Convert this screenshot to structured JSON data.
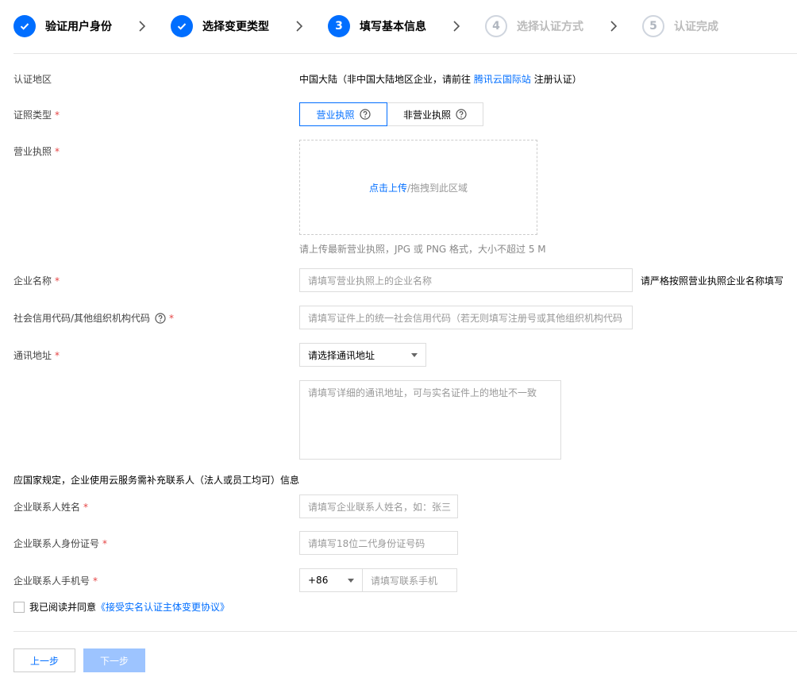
{
  "steps": [
    {
      "label": "验证用户身份",
      "state": "done",
      "number": ""
    },
    {
      "label": "选择变更类型",
      "state": "done",
      "number": ""
    },
    {
      "label": "填写基本信息",
      "state": "active",
      "number": "3"
    },
    {
      "label": "选择认证方式",
      "state": "todo",
      "number": "4"
    },
    {
      "label": "认证完成",
      "state": "todo",
      "number": "5"
    }
  ],
  "region": {
    "label": "认证地区",
    "value_prefix": "中国大陆（非中国大陆地区企业，请前往",
    "link": "腾讯云国际站",
    "value_suffix": "注册认证）"
  },
  "license_type": {
    "label": "证照类型",
    "required": "*",
    "options": [
      "营业执照",
      "非营业执照"
    ],
    "selected": "营业执照"
  },
  "license_upload": {
    "label": "营业执照",
    "required": "*",
    "link": "点击上传",
    "text": "/拖拽到此区域",
    "hint": "请上传最新营业执照，JPG 或 PNG 格式，大小不超过 5 M"
  },
  "company_name": {
    "label": "企业名称",
    "required": "*",
    "placeholder": "请填写营业执照上的企业名称",
    "note": "请严格按照营业执照企业名称填写"
  },
  "credit_code": {
    "label": "社会信用代码/其他组织机构代码",
    "required": "*",
    "placeholder": "请填写证件上的统一社会信用代码（若无则填写注册号或其他组织机构代码"
  },
  "address": {
    "label": "通讯地址",
    "required": "*",
    "select_value": "请选择通讯地址",
    "detail_placeholder": "请填写详细的通讯地址，可与实名证件上的地址不一致"
  },
  "contact_note": "应国家规定，企业使用云服务需补充联系人（法人或员工均可）信息",
  "contact_name": {
    "label": "企业联系人姓名",
    "required": "*",
    "placeholder": "请填写企业联系人姓名，如：张三"
  },
  "contact_id": {
    "label": "企业联系人身份证号",
    "required": "*",
    "placeholder": "请填写18位二代身份证号码"
  },
  "contact_phone": {
    "label": "企业联系人手机号",
    "required": "*",
    "country_code": "+86",
    "placeholder": "请填写联系手机"
  },
  "agreement": {
    "text": "我已阅读并同意",
    "link": "《接受实名认证主体变更协议》"
  },
  "buttons": {
    "prev": "上一步",
    "next": "下一步"
  },
  "colors": {
    "accent": "#006eff",
    "required": "#e54545",
    "disabled_button": "#9dc4ff"
  }
}
